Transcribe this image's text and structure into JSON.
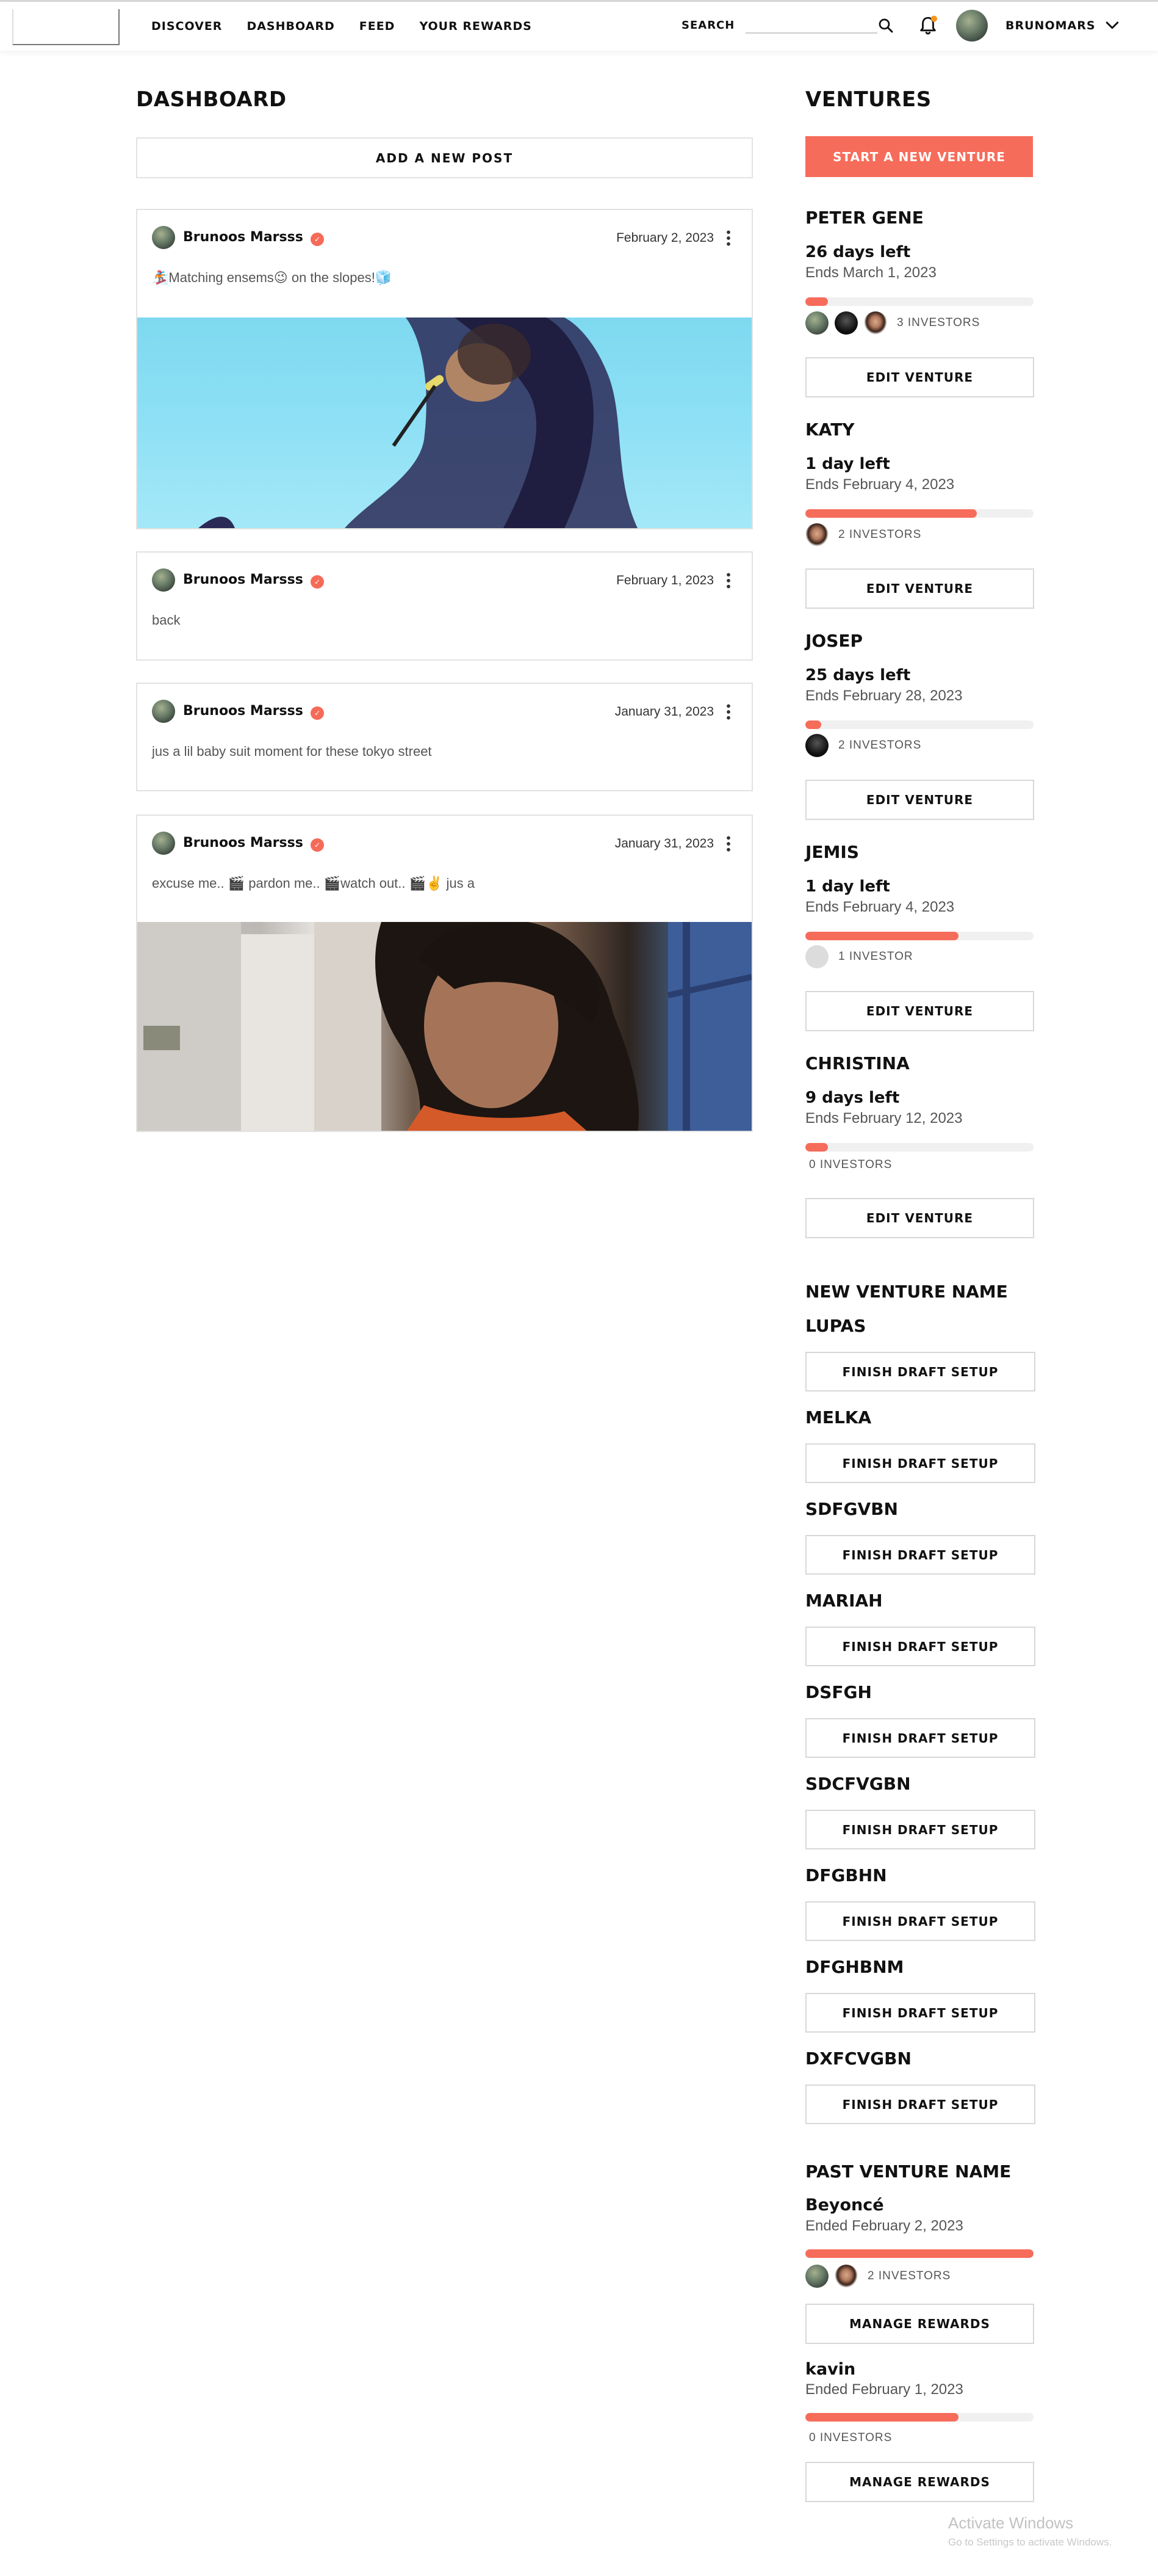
{
  "nav": {
    "items": [
      "DISCOVER",
      "DASHBOARD",
      "FEED",
      "YOUR REWARDS"
    ],
    "search_label": "SEARCH",
    "search_value": "",
    "username": "BRUNOMARS"
  },
  "dashboard": {
    "title": "DASHBOARD",
    "add_post_label": "ADD A NEW POST",
    "posts": [
      {
        "author": "Brunoos Marsss",
        "date": "February 2, 2023",
        "text": "🏂Matching ensems😉 on the slopes!🧊",
        "has_image": true
      },
      {
        "author": "Brunoos Marsss",
        "date": "February 1, 2023",
        "text": "back",
        "has_image": false
      },
      {
        "author": "Brunoos Marsss",
        "date": "January 31, 2023",
        "text": "jus a lil baby suit moment for these tokyo street",
        "has_image": false
      },
      {
        "author": "Brunoos Marsss",
        "date": "January 31, 2023",
        "text": "excuse me.. 🎬 pardon me.. 🎬watch out.. 🎬✌️ jus a",
        "has_image": true
      }
    ]
  },
  "ventures": {
    "title": "VENTURES",
    "start_label": "START A NEW VENTURE",
    "edit_label": "EDIT VENTURE",
    "active": [
      {
        "name": "PETER GENE",
        "days_left": "26 days left",
        "ends": "Ends March 1, 2023",
        "progress": 0.1,
        "investors": "3 INVESTORS"
      },
      {
        "name": "KATY",
        "days_left": "1 day left",
        "ends": "Ends February 4, 2023",
        "progress": 0.75,
        "investors": "2 INVESTORS"
      },
      {
        "name": "JOSEP",
        "days_left": "25 days left",
        "ends": "Ends February 28, 2023",
        "progress": 0.07,
        "investors": "2 INVESTORS"
      },
      {
        "name": "JEMIS",
        "days_left": "1 day left",
        "ends": "Ends February 4, 2023",
        "progress": 0.67,
        "investors": "1 INVESTOR"
      },
      {
        "name": "CHRISTINA",
        "days_left": "9 days left",
        "ends": "Ends February 12, 2023",
        "progress": 0.1,
        "investors": "0 INVESTORS"
      }
    ],
    "drafts_title": "NEW VENTURE NAME",
    "draft_button_label": "FINISH DRAFT SETUP",
    "drafts": [
      "LUPAS",
      "MELKA",
      "SDFGVBN",
      "MARIAH",
      "DSFGH",
      "SDCFVGBN",
      "DFGBHN",
      "DFGHBNM",
      "DXFCVGBN"
    ],
    "past_title": "PAST VENTURE NAME",
    "manage_label": "MANAGE REWARDS",
    "past": [
      {
        "name": "Beyoncé",
        "ended": "Ended February 2, 2023",
        "progress": 1.0,
        "investors": "2 INVESTORS"
      },
      {
        "name": "kavin",
        "ended": "Ended February 1, 2023",
        "progress": 0.67,
        "investors": "0 INVESTORS"
      }
    ]
  },
  "watermark": {
    "line1": "Activate Windows",
    "line2": "Go to Settings to activate Windows."
  },
  "colors": {
    "accent": "#f66c5a",
    "border": "#e2e2e2"
  }
}
